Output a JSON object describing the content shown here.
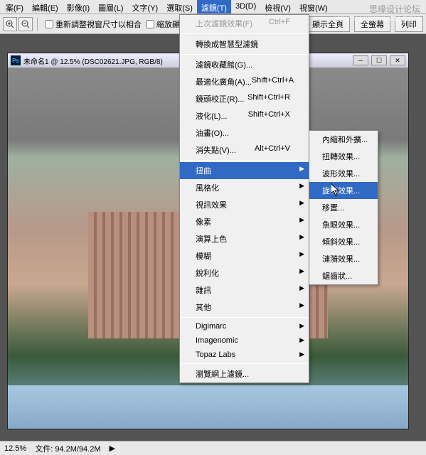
{
  "menubar": {
    "items": [
      "案(F)",
      "編輯(E)",
      "影像(I)",
      "圖層(L)",
      "文字(Y)",
      "選取(S)",
      "濾鏡(T)",
      "3D(D)",
      "檢視(V)",
      "視窗(W)"
    ],
    "active_index": 6
  },
  "toolbar": {
    "resize_label": "重新調整視窗尺寸以相合",
    "zoom_all_label": "縮放顯示",
    "show_page_label": "顯示全頁",
    "full_screen_label": "全螢幕",
    "print_label": "列印"
  },
  "document": {
    "title": "未命名1 @ 12.5% (DSC02621.JPG, RGB/8)"
  },
  "filter_menu": {
    "last_filter": "上次濾鏡效果(F)",
    "last_filter_key": "Ctrl+F",
    "smart_filter": "轉換成智慧型濾鏡",
    "gallery": "濾鏡收藏館(G)...",
    "adaptive": "最適化廣角(A)...",
    "adaptive_key": "Shift+Ctrl+A",
    "lens": "鏡頭校正(R)...",
    "lens_key": "Shift+Ctrl+R",
    "liquify": "液化(L)...",
    "liquify_key": "Shift+Ctrl+X",
    "oil": "油畫(O)...",
    "vanish": "消失點(V)...",
    "vanish_key": "Alt+Ctrl+V",
    "distort": "扭曲",
    "stylize": "風格化",
    "video": "視訊效果",
    "pixelate": "像素",
    "render": "演算上色",
    "blur": "模糊",
    "sharpen": "銳利化",
    "noise": "雜訊",
    "other": "其他",
    "digimarc": "Digimarc",
    "imagenomic": "Imagenomic",
    "topaz": "Topaz Labs",
    "browse": "瀏覽網上濾鏡..."
  },
  "distort_submenu": {
    "items": [
      "內縮和外擴...",
      "扭轉效果...",
      "波形效果...",
      "旋轉效果...",
      "移置...",
      "魚眼效果...",
      "傾斜效果...",
      "漣漪效果...",
      "鋸齒狀..."
    ],
    "hover_index": 3
  },
  "statusbar": {
    "zoom": "12.5%",
    "doc_size": "文件: 94.2M/94.2M"
  },
  "watermark": {
    "cn": "思缘设计论坛",
    "url": "WWW.MISSYUAN.COM"
  }
}
